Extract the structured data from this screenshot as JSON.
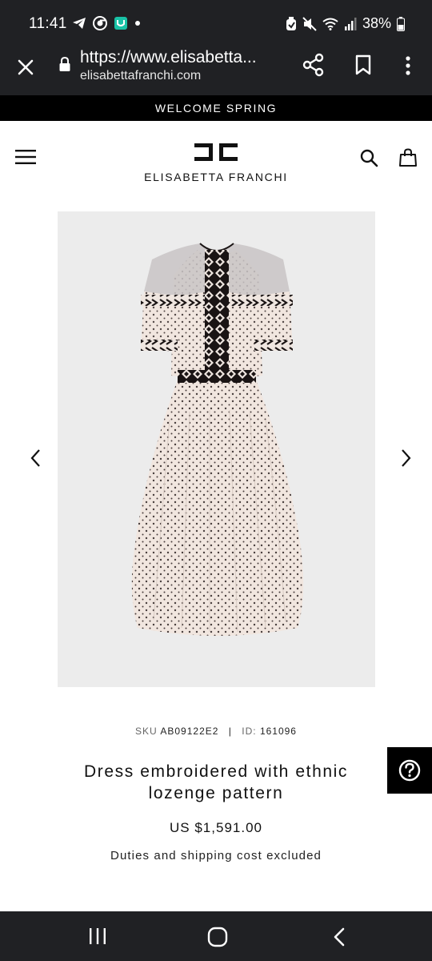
{
  "status_bar": {
    "time": "11:41",
    "battery": "38%"
  },
  "browser": {
    "url": "https://www.elisabetta...",
    "domain": "elisabettafranchi.com"
  },
  "announcement": "WELCOME SPRING",
  "site": {
    "brand": "ELISABETTA FRANCHI"
  },
  "product": {
    "sku_label": "SKU",
    "sku": "AB09122E2",
    "id_label": "ID:",
    "id": "161096",
    "title": "Dress embroidered with ethnic lozenge pattern",
    "price": "US $1,591.00",
    "duties_note": "Duties and shipping cost excluded"
  },
  "colors": {
    "system_bar": "#202124",
    "announce_bg": "#000000",
    "image_bg": "#ececec"
  }
}
